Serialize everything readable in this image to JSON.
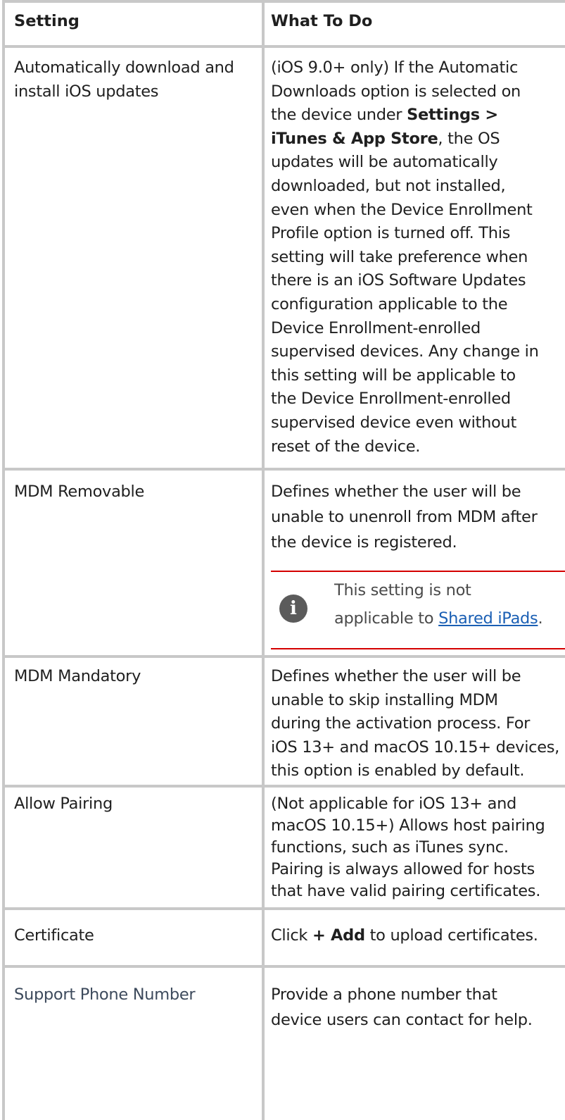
{
  "header": {
    "col1": "Setting",
    "col2": "What To Do"
  },
  "rows": {
    "auto_update": {
      "setting_lines": [
        "Automatically download and",
        "install iOS updates"
      ],
      "desc": {
        "l1": "(iOS 9.0+ only) If the Automatic",
        "l2": "Downloads option is selected on",
        "l3_a": "the device under ",
        "l3_b": "Settings >",
        "l4_a": "iTunes & App Store",
        "l4_b": ", the OS",
        "l5": "updates will be automatically",
        "l6": "downloaded, but not installed,",
        "l7": "even when the Device Enrollment",
        "l8": "Profile option is turned off. This",
        "l9": "setting will take preference when",
        "l10": "there is an iOS Software Updates",
        "l11": "configuration applicable to the",
        "l12": "Device Enrollment-enrolled",
        "l13": "supervised devices. Any change in",
        "l14": "this setting will be applicable to",
        "l15": "the Device Enrollment-enrolled",
        "l16": "supervised device even without",
        "l17": "reset of the device."
      }
    },
    "mdm_removable": {
      "setting": "MDM Removable",
      "desc_lines": [
        "Defines whether the user will be",
        "unable to unenroll from MDM after",
        "the device is registered."
      ],
      "note": {
        "icon": "info-icon",
        "line1": "This setting is not",
        "line2_prefix": "applicable to ",
        "link": "Shared iPads",
        "suffix": "."
      }
    },
    "mdm_mandatory": {
      "setting": "MDM Mandatory",
      "desc_lines": [
        "Defines whether the user will be",
        "unable to skip installing MDM",
        "during the activation process. For",
        "iOS 13+ and macOS 10.15+ devices,",
        "this option is enabled by default."
      ]
    },
    "allow_pairing": {
      "setting": "Allow Pairing",
      "desc_lines": [
        "(Not applicable for iOS 13+ and",
        "macOS 10.15+) Allows host pairing",
        "functions, such as iTunes sync.",
        "Pairing is always allowed for hosts",
        "that have valid pairing certificates."
      ]
    },
    "certificate": {
      "setting": "Certificate",
      "desc_a": "Click ",
      "desc_b": "+ Add",
      "desc_c": " to upload certificates."
    },
    "support_phone": {
      "setting": "Support Phone Number",
      "desc_lines": [
        "Provide a phone number that",
        "device users can contact for help."
      ]
    }
  }
}
